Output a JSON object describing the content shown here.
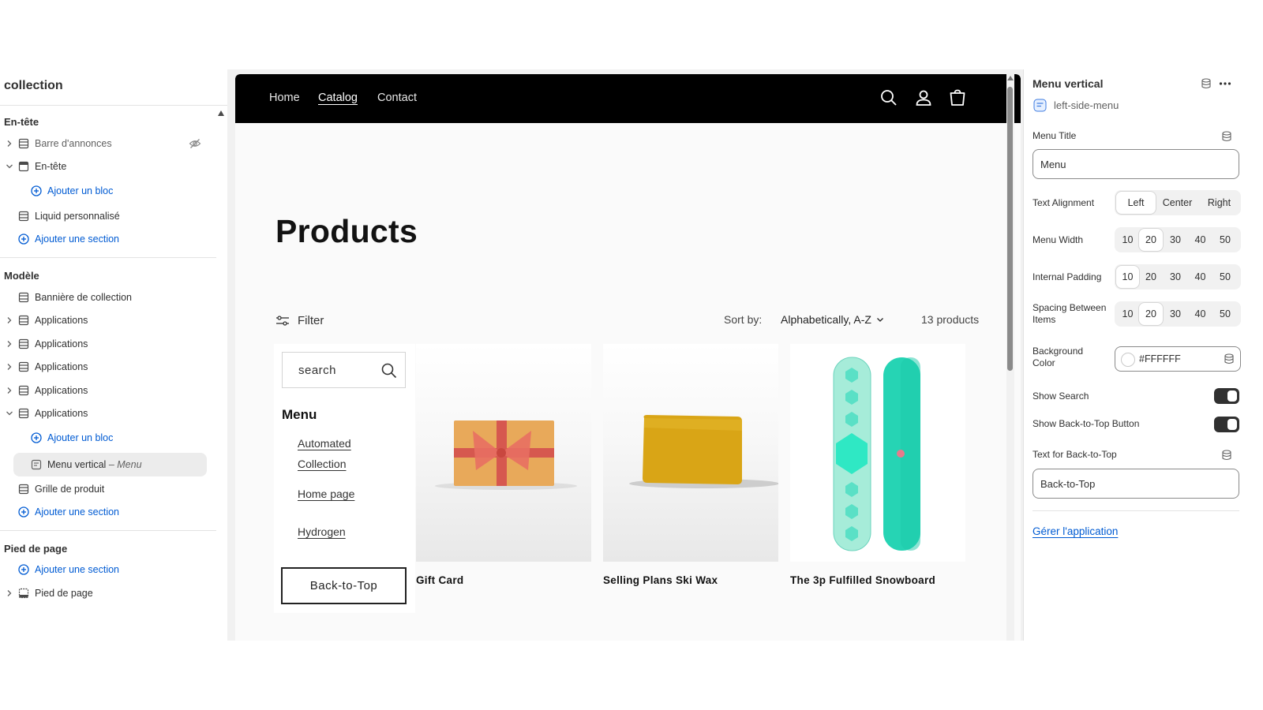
{
  "sidebar": {
    "title": "collection",
    "sections": {
      "header": "En-tête",
      "template": "Modèle",
      "footer": "Pied de page"
    },
    "items": {
      "announcement_bar": "Barre d'annonces",
      "header_group": "En-tête",
      "add_block_1": "Ajouter un bloc",
      "custom_liquid": "Liquid personnalisé",
      "add_section_1": "Ajouter une section",
      "collection_banner": "Bannière de collection",
      "apps": [
        "Applications",
        "Applications",
        "Applications",
        "Applications",
        "Applications"
      ],
      "add_block_2": "Ajouter un bloc",
      "menu_vertical": "Menu vertical",
      "menu_vertical_sub": "– Menu",
      "product_grid": "Grille de produit",
      "add_section_2": "Ajouter une section",
      "add_section_3": "Ajouter une section",
      "footer_group": "Pied de page"
    }
  },
  "store": {
    "nav": [
      "Home",
      "Catalog",
      "Contact"
    ],
    "active_nav": "Catalog",
    "page_title": "Products",
    "filter_label": "Filter",
    "sort_label": "Sort by:",
    "sort_value": "Alphabetically, A-Z",
    "product_count": "13 products",
    "menu_block": {
      "search_placeholder": "search",
      "title": "Menu",
      "links": [
        "Automated Collection",
        "Home page",
        "Hydrogen"
      ],
      "back_to_top": "Back-to-Top"
    },
    "products": [
      {
        "name": "Gift Card",
        "image": "gift-card-image"
      },
      {
        "name": "Selling Plans Ski Wax",
        "image": "ski-wax-image"
      },
      {
        "name": "The 3p Fulfilled Snowboard",
        "image": "snowboard-image"
      }
    ]
  },
  "settings": {
    "block_title": "Menu vertical",
    "app_handle": "left-side-menu",
    "menu_title_label": "Menu Title",
    "menu_title_value": "Menu",
    "text_alignment_label": "Text Alignment",
    "text_alignment_options": [
      "Left",
      "Center",
      "Right"
    ],
    "text_alignment_selected": "Left",
    "menu_width_label": "Menu Width",
    "menu_width_options": [
      "10",
      "20",
      "30",
      "40",
      "50"
    ],
    "menu_width_selected": "20",
    "internal_padding_label": "Internal Padding",
    "internal_padding_options": [
      "10",
      "20",
      "30",
      "40",
      "50"
    ],
    "internal_padding_selected": "10",
    "spacing_label": "Spacing Between Items",
    "spacing_options": [
      "10",
      "20",
      "30",
      "40",
      "50"
    ],
    "spacing_selected": "20",
    "bg_color_label": "Background Color",
    "bg_color_value": "#FFFFFF",
    "show_search_label": "Show Search",
    "show_search_on": true,
    "show_back_top_label": "Show Back-to-Top Button",
    "show_back_top_on": true,
    "back_top_text_label": "Text for Back-to-Top",
    "back_top_text_value": "Back-to-Top",
    "manage_app_link": "Gérer l'application"
  },
  "colors": {
    "link_blue": "#005bd3",
    "header_black": "#000000",
    "text_dark": "#303030"
  }
}
